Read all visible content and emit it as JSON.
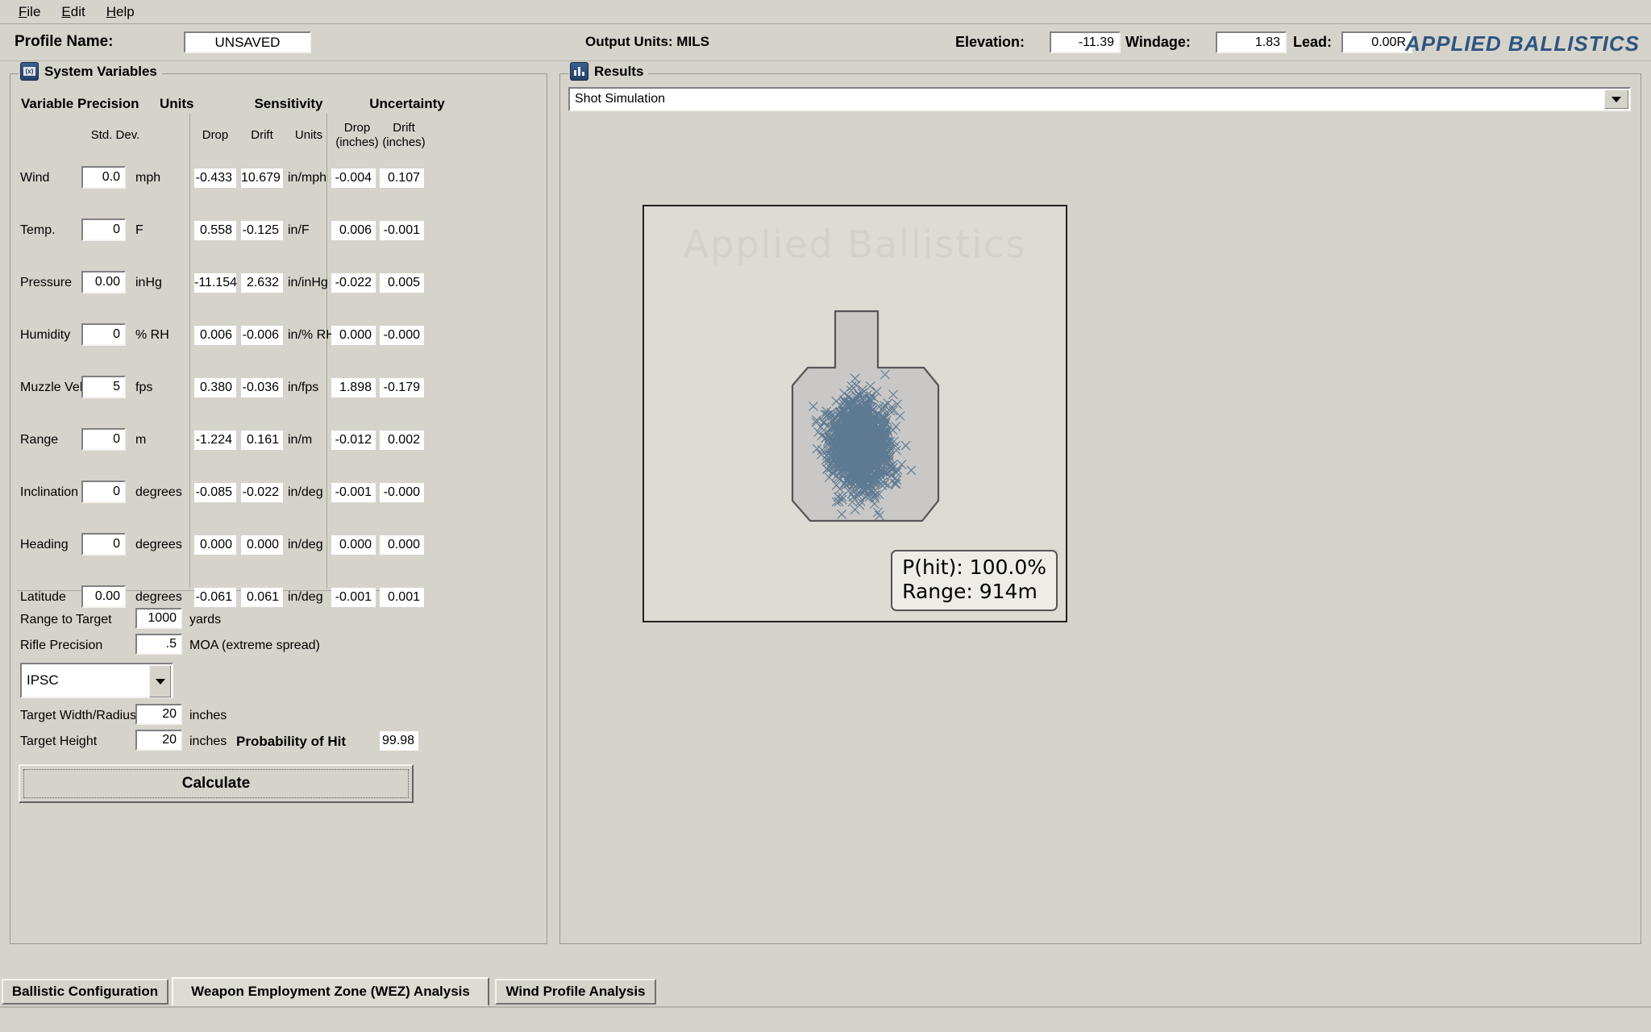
{
  "menu": {
    "items": [
      {
        "label": "File",
        "accel": "F"
      },
      {
        "label": "Edit",
        "accel": "E"
      },
      {
        "label": "Help",
        "accel": "H"
      }
    ]
  },
  "header": {
    "profile_label": "Profile Name:",
    "profile_value": "UNSAVED",
    "output_units": "Output Units: MILS",
    "elevation_label": "Elevation:",
    "elevation_value": "-11.39",
    "windage_label": "Windage:",
    "windage_value": "1.83",
    "lead_label": "Lead:",
    "lead_value": "0.00R",
    "brand": "APPLIED BALLISTICS",
    "brand_color": "#2d5580"
  },
  "system_variables": {
    "title": "System Variables",
    "headers": {
      "variable": "Variable",
      "precision": "Precision",
      "units": "Units",
      "sensitivity": "Sensitivity",
      "uncertainty": "Uncertainty",
      "std_dev": "Std. Dev.",
      "sens_drop": "Drop",
      "sens_drift": "Drift",
      "sens_units": "Units",
      "unc_drop_l1": "Drop",
      "unc_drop_l2": "(inches)",
      "unc_drift_l1": "Drift",
      "unc_drift_l2": "(inches)"
    },
    "rows": [
      {
        "name": "Wind",
        "std_dev": "0.0",
        "units": "mph",
        "sens_drop": "-0.433",
        "sens_drift": "10.679",
        "sens_units": "in/mph",
        "unc_drop": "-0.004",
        "unc_drift": "0.107"
      },
      {
        "name": "Temp.",
        "std_dev": "0",
        "units": "F",
        "sens_drop": "0.558",
        "sens_drift": "-0.125",
        "sens_units": "in/F",
        "unc_drop": "0.006",
        "unc_drift": "-0.001"
      },
      {
        "name": "Pressure",
        "std_dev": "0.00",
        "units": "inHg",
        "sens_drop": "-11.154",
        "sens_drift": "2.632",
        "sens_units": "in/inHg",
        "unc_drop": "-0.022",
        "unc_drift": "0.005"
      },
      {
        "name": "Humidity",
        "std_dev": "0",
        "units": "% RH",
        "sens_drop": "0.006",
        "sens_drift": "-0.006",
        "sens_units": "in/% RH",
        "unc_drop": "0.000",
        "unc_drift": "-0.000"
      },
      {
        "name": "Muzzle Vel.",
        "std_dev": "5",
        "units": "fps",
        "sens_drop": "0.380",
        "sens_drift": "-0.036",
        "sens_units": "in/fps",
        "unc_drop": "1.898",
        "unc_drift": "-0.179"
      },
      {
        "name": "Range",
        "std_dev": "0",
        "units": "m",
        "sens_drop": "-1.224",
        "sens_drift": "0.161",
        "sens_units": "in/m",
        "unc_drop": "-0.012",
        "unc_drift": "0.002"
      },
      {
        "name": "Inclination",
        "std_dev": "0",
        "units": "degrees",
        "sens_drop": "-0.085",
        "sens_drift": "-0.022",
        "sens_units": "in/deg",
        "unc_drop": "-0.001",
        "unc_drift": "-0.000"
      },
      {
        "name": "Heading",
        "std_dev": "0",
        "units": "degrees",
        "sens_drop": "0.000",
        "sens_drift": "0.000",
        "sens_units": "in/deg",
        "unc_drop": "0.000",
        "unc_drift": "0.000"
      },
      {
        "name": "Latitude",
        "std_dev": "0.00",
        "units": "degrees",
        "sens_drop": "-0.061",
        "sens_drift": "0.061",
        "sens_units": "in/deg",
        "unc_drop": "-0.001",
        "unc_drift": "0.001"
      }
    ]
  },
  "target_setup": {
    "range_label": "Range to Target",
    "range_value": "1000",
    "range_units": "yards",
    "precision_label": "Rifle Precision",
    "precision_value": ".5",
    "precision_units": "MOA (extreme spread)",
    "target_type": "IPSC",
    "width_label": "Target Width/Radius",
    "width_value": "20",
    "width_units": "inches",
    "height_label": "Target Height",
    "height_value": "20",
    "height_units": "inches",
    "phit_label": "Probability of Hit",
    "phit_value": "99.98",
    "calculate_label": "Calculate"
  },
  "results": {
    "title": "Results",
    "selected_view": "Shot Simulation",
    "watermark": "Applied Ballistics",
    "phit_line1": "P(hit): 100.0%",
    "phit_line2": "Range: 914m",
    "impact_color": "#3a5f80",
    "silhouette_fill": "#c9c8c6",
    "silhouette_stroke": "#555555"
  },
  "tabs": [
    {
      "label": "Ballistic Configuration",
      "active": false
    },
    {
      "label": "Weapon Employment Zone (WEZ) Analysis",
      "active": true
    },
    {
      "label": "Wind Profile Analysis",
      "active": false
    }
  ]
}
